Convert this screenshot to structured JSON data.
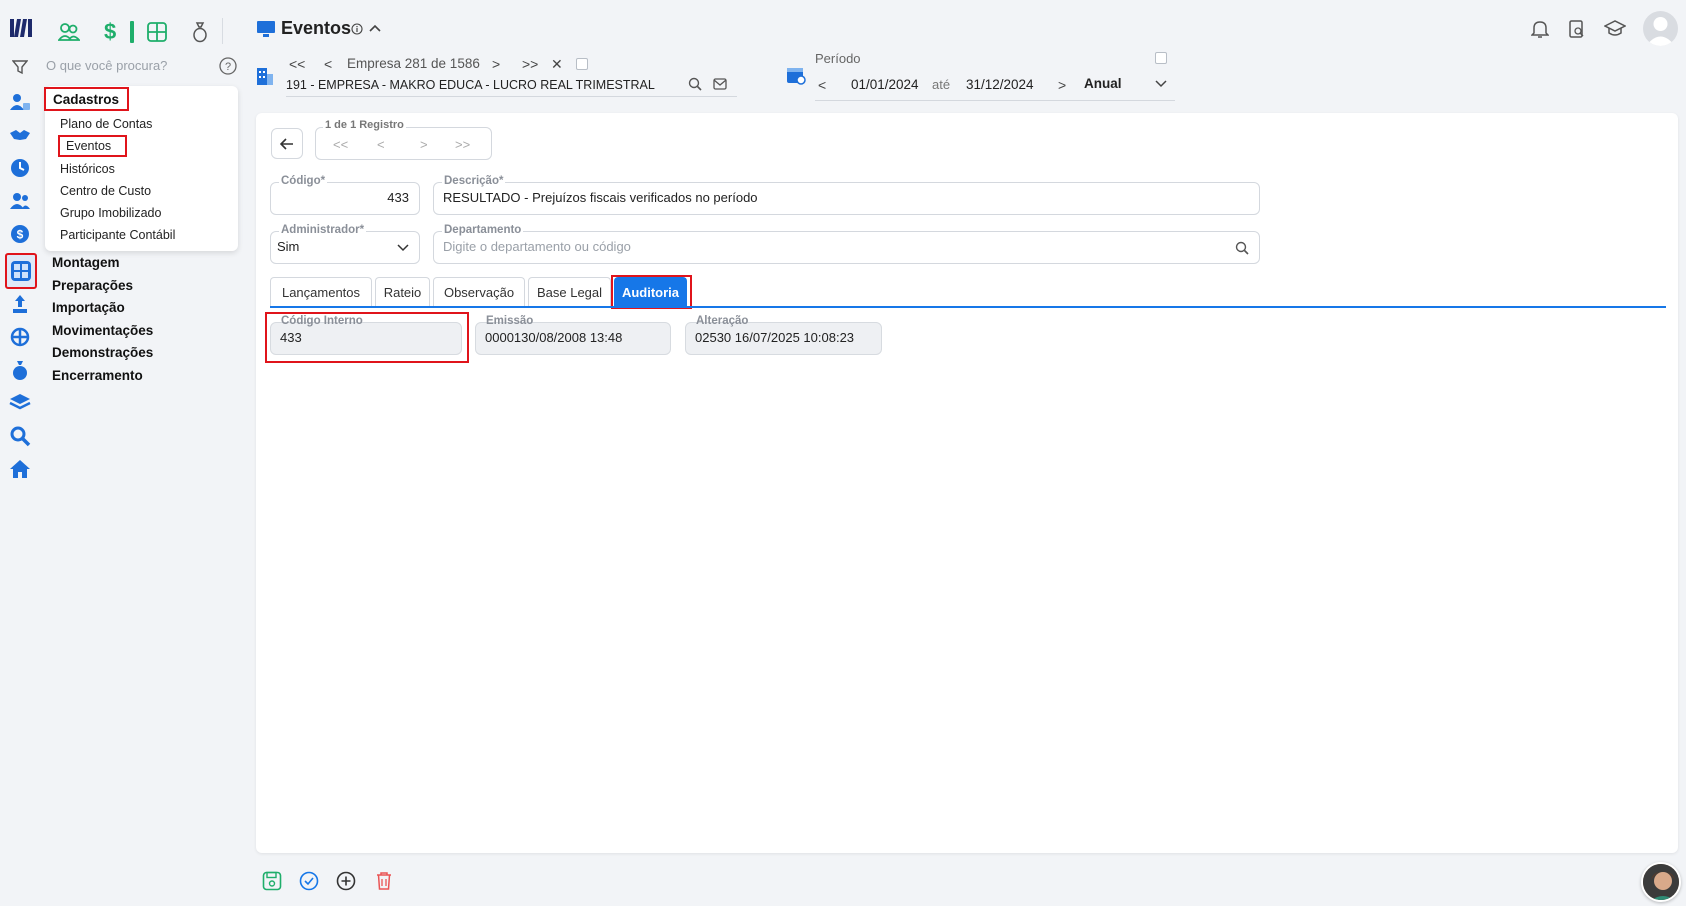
{
  "header": {
    "title": "Eventos",
    "search_placeholder": "O que você procura?"
  },
  "company_nav": {
    "position": "Empresa 281 de 1586",
    "company_name": "191 - EMPRESA - MAKRO EDUCA - LUCRO REAL TRIMESTRAL"
  },
  "period": {
    "label": "Período",
    "start": "01/01/2024",
    "until": "até",
    "end": "31/12/2024",
    "mode": "Anual"
  },
  "menu": {
    "section": "Cadastros",
    "items": [
      "Plano de Contas",
      "Eventos",
      "Históricos",
      "Centro de Custo",
      "Grupo Imobilizado",
      "Participante Contábil"
    ],
    "groups": [
      "Montagem",
      "Preparações",
      "Importação",
      "Movimentações",
      "Demonstrações",
      "Encerramento"
    ]
  },
  "record_nav": {
    "label": "1 de 1 Registro"
  },
  "form": {
    "codigo": {
      "label": "Código*",
      "value": "433"
    },
    "descricao": {
      "label": "Descrição*",
      "value": "RESULTADO - Prejuízos fiscais verificados no período"
    },
    "administrador": {
      "label": "Administrador*",
      "value": "Sim"
    },
    "departamento": {
      "label": "Departamento",
      "placeholder": "Digite o departamento ou código"
    }
  },
  "tabs": [
    "Lançamentos",
    "Rateio",
    "Observação",
    "Base Legal",
    "Auditoria"
  ],
  "active_tab": "Auditoria",
  "audit": {
    "codigo_interno": {
      "label": "Código Interno",
      "value": "433"
    },
    "emissao": {
      "label": "Emissão",
      "value": "0000130/08/2008 13:48"
    },
    "alteracao": {
      "label": "Alteração",
      "value": "02530 16/07/2025 10:08:23"
    }
  },
  "colors": {
    "accent": "#1677e8",
    "highlight": "#e0141b",
    "green": "#1fae6b",
    "danger": "#ea5455"
  }
}
